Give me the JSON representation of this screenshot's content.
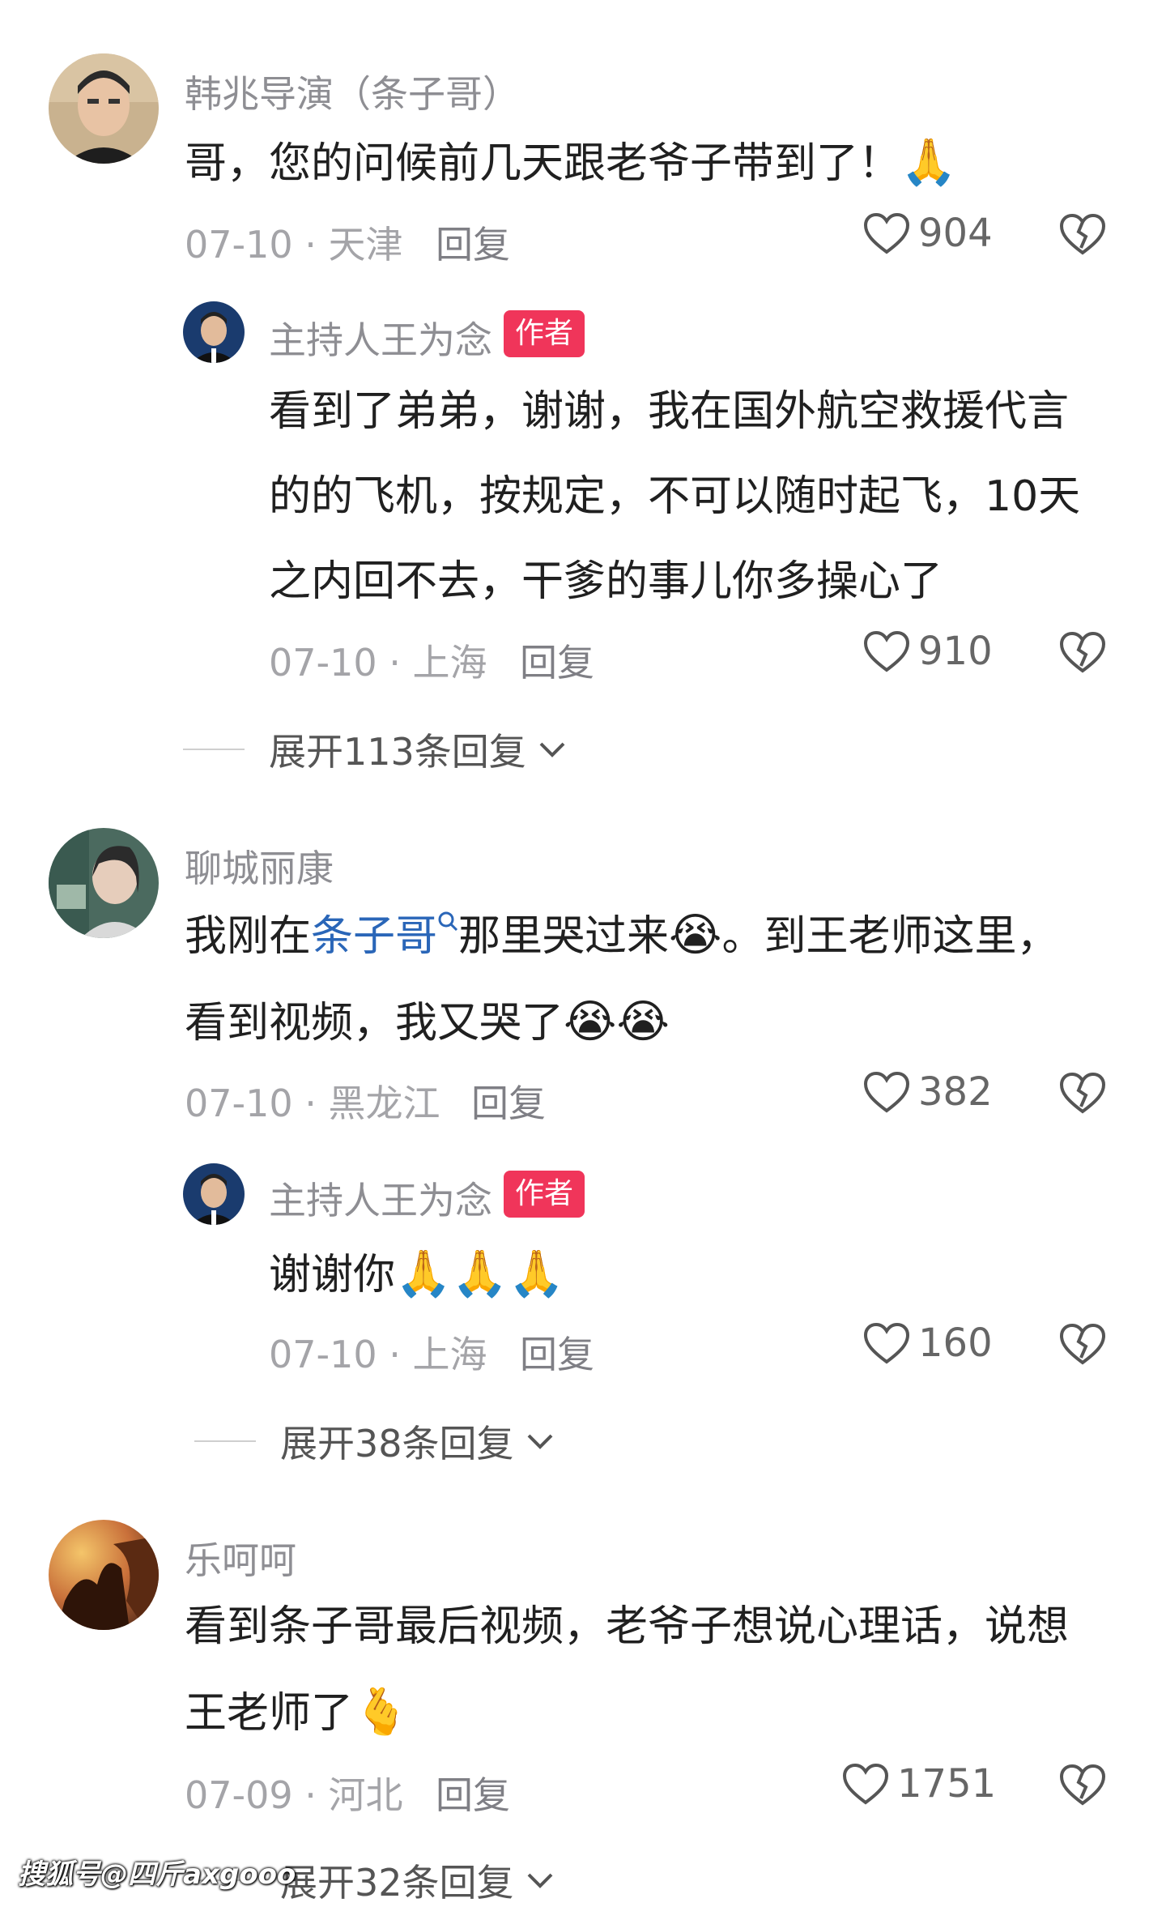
{
  "comments": [
    {
      "user": "韩兆导演（条子哥）",
      "text": "哥，您的问候前几天跟老爷子带到了！",
      "emoji": "🙏",
      "date": "07-10 · 天津",
      "reply_label": "回复",
      "likes": "904",
      "replies": [
        {
          "user": "主持人王为念",
          "badge": "作者",
          "lines": [
            "看到了弟弟，谢谢，我在国外航空救援代言",
            "的的飞机，按规定，不可以随时起飞，10天",
            "之内回不去，干爹的事儿你多操心了"
          ],
          "date": "07-10 · 上海",
          "reply_label": "回复",
          "likes": "910"
        }
      ],
      "expand": "展开113条回复"
    },
    {
      "user": "聊城丽康",
      "text_pre": "我刚在",
      "text_link": "条子哥",
      "text_post": "那里哭过来",
      "text_post2": "。到王老师这里，",
      "line2": "看到视频，我又哭了",
      "emoji_cry": "😭",
      "date": "07-10 · 黑龙江",
      "reply_label": "回复",
      "likes": "382",
      "replies": [
        {
          "user": "主持人王为念",
          "badge": "作者",
          "text": "谢谢你",
          "emoji": "🙏🙏🙏",
          "date": "07-10 · 上海",
          "reply_label": "回复",
          "likes": "160"
        }
      ],
      "expand": "展开38条回复"
    },
    {
      "user": "乐呵呵",
      "line1": "看到条子哥最后视频，老爷子想说心理话，说想",
      "line2": "王老师了",
      "emoji": "🫰",
      "date": "07-09 · 河北",
      "reply_label": "回复",
      "likes": "1751",
      "expand": "展开32条回复"
    }
  ],
  "watermark": "搜狐号@四斤axgooo"
}
